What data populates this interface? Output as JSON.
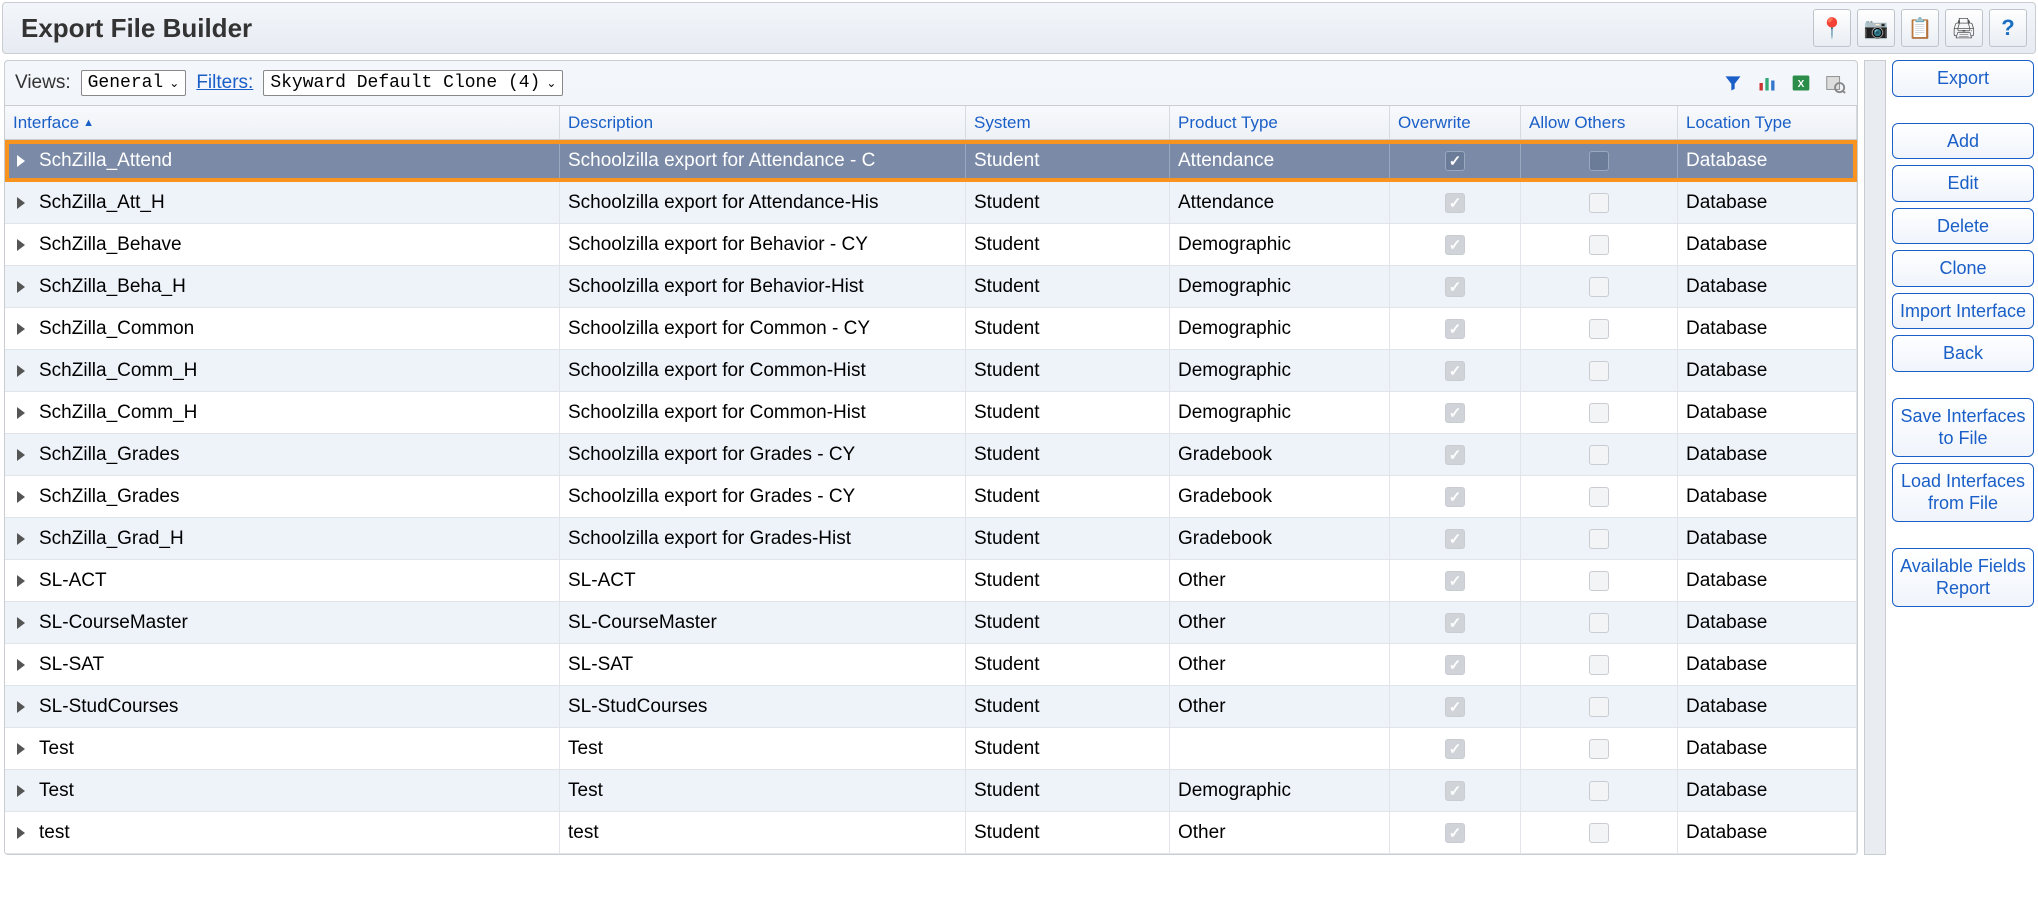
{
  "header": {
    "title": "Export File Builder"
  },
  "toolbar": {
    "views_label": "Views:",
    "views_value": "General",
    "filters_label": "Filters:",
    "filters_value": "Skyward Default Clone (4)"
  },
  "columns": {
    "interface": "Interface",
    "description": "Description",
    "system": "System",
    "product_type": "Product Type",
    "overwrite": "Overwrite",
    "allow_others": "Allow Others",
    "location_type": "Location Type"
  },
  "rows": [
    {
      "iface": "SchZilla_Attend",
      "desc": "Schoolzilla export for Attendance - C",
      "system": "Student",
      "ptype": "Attendance",
      "over": true,
      "allow": false,
      "loc": "Database",
      "selected": true
    },
    {
      "iface": "SchZilla_Att_H",
      "desc": "Schoolzilla export for Attendance-His",
      "system": "Student",
      "ptype": "Attendance",
      "over": true,
      "allow": false,
      "loc": "Database"
    },
    {
      "iface": "SchZilla_Behave",
      "desc": "Schoolzilla export for Behavior - CY",
      "system": "Student",
      "ptype": "Demographic",
      "over": true,
      "allow": false,
      "loc": "Database"
    },
    {
      "iface": "SchZilla_Beha_H",
      "desc": "Schoolzilla export for Behavior-Hist",
      "system": "Student",
      "ptype": "Demographic",
      "over": true,
      "allow": false,
      "loc": "Database"
    },
    {
      "iface": "SchZilla_Common",
      "desc": "Schoolzilla export for Common - CY",
      "system": "Student",
      "ptype": "Demographic",
      "over": true,
      "allow": false,
      "loc": "Database"
    },
    {
      "iface": "SchZilla_Comm_H",
      "desc": "Schoolzilla export for Common-Hist",
      "system": "Student",
      "ptype": "Demographic",
      "over": true,
      "allow": false,
      "loc": "Database"
    },
    {
      "iface": "SchZilla_Comm_H",
      "desc": "Schoolzilla export for Common-Hist",
      "system": "Student",
      "ptype": "Demographic",
      "over": true,
      "allow": false,
      "loc": "Database"
    },
    {
      "iface": "SchZilla_Grades",
      "desc": "Schoolzilla export for Grades - CY",
      "system": "Student",
      "ptype": "Gradebook",
      "over": true,
      "allow": false,
      "loc": "Database"
    },
    {
      "iface": "SchZilla_Grades",
      "desc": "Schoolzilla export for Grades - CY",
      "system": "Student",
      "ptype": "Gradebook",
      "over": true,
      "allow": false,
      "loc": "Database"
    },
    {
      "iface": "SchZilla_Grad_H",
      "desc": "Schoolzilla export for Grades-Hist",
      "system": "Student",
      "ptype": "Gradebook",
      "over": true,
      "allow": false,
      "loc": "Database"
    },
    {
      "iface": "SL-ACT",
      "desc": "SL-ACT",
      "system": "Student",
      "ptype": "Other",
      "over": true,
      "allow": false,
      "loc": "Database"
    },
    {
      "iface": "SL-CourseMaster",
      "desc": "SL-CourseMaster",
      "system": "Student",
      "ptype": "Other",
      "over": true,
      "allow": false,
      "loc": "Database"
    },
    {
      "iface": "SL-SAT",
      "desc": "SL-SAT",
      "system": "Student",
      "ptype": "Other",
      "over": true,
      "allow": false,
      "loc": "Database"
    },
    {
      "iface": "SL-StudCourses",
      "desc": "SL-StudCourses",
      "system": "Student",
      "ptype": "Other",
      "over": true,
      "allow": false,
      "loc": "Database"
    },
    {
      "iface": "Test",
      "desc": "Test",
      "system": "Student",
      "ptype": "",
      "over": true,
      "allow": false,
      "loc": "Database"
    },
    {
      "iface": "Test",
      "desc": "Test",
      "system": "Student",
      "ptype": "Demographic",
      "over": true,
      "allow": false,
      "loc": "Database"
    },
    {
      "iface": "test",
      "desc": "test",
      "system": "Student",
      "ptype": "Other",
      "over": true,
      "allow": false,
      "loc": "Database"
    }
  ],
  "buttons": {
    "export": "Export",
    "add": "Add",
    "edit": "Edit",
    "delete": "Delete",
    "clone": "Clone",
    "import_interface": "Import Interface",
    "back": "Back",
    "save_to_file": "Save Interfaces to File",
    "load_from_file": "Load Interfaces from File",
    "fields_report": "Available Fields Report"
  }
}
